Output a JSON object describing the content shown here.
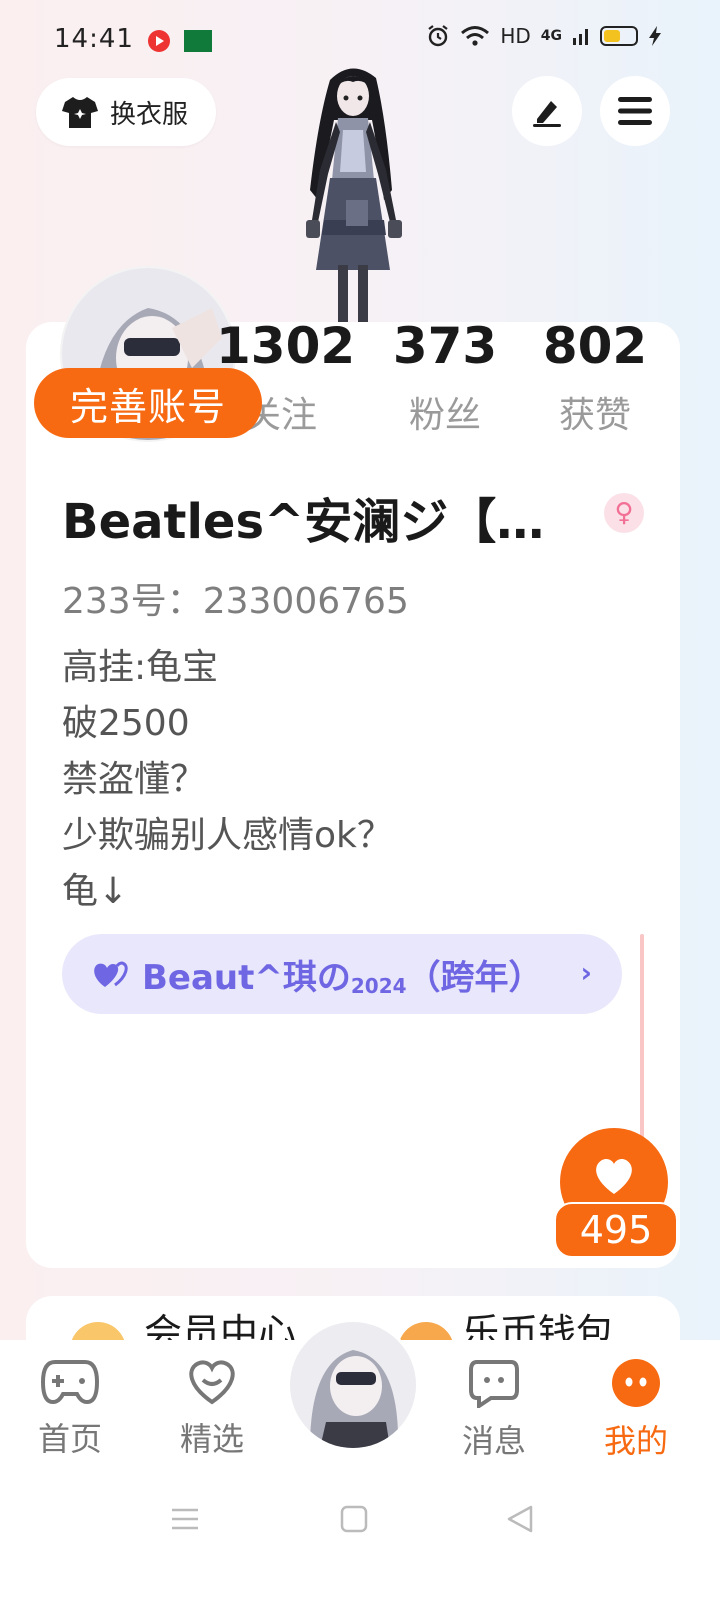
{
  "status_bar": {
    "time": "14:41",
    "network": "HD",
    "signal": "4G"
  },
  "header": {
    "outfit_label": "换衣服"
  },
  "profile": {
    "stats": [
      {
        "value": "1302",
        "label": "关注"
      },
      {
        "value": "373",
        "label": "粉丝"
      },
      {
        "value": "802",
        "label": "获赞"
      }
    ],
    "complete_account_label": "完善账号",
    "username": "Beatles^安澜ジ【…",
    "gender_symbol": "♀",
    "user_id": "233号：233006765",
    "bio_lines": [
      "高挂:龟宝",
      "破2500",
      "禁盗懂？",
      "少欺骗别人感情ok？",
      "龟↓"
    ],
    "cp": {
      "name": "Beaut^琪の",
      "sub": "2024",
      "suffix": "（跨年）"
    },
    "like_count": "495"
  },
  "services": {
    "member_center": "会员中心",
    "wallet": "乐币钱包"
  },
  "bottom_nav": {
    "items": [
      {
        "label": "首页"
      },
      {
        "label": "精选"
      },
      {
        "label": "消息"
      },
      {
        "label": "我的"
      }
    ],
    "active_color": "#f76a12"
  }
}
